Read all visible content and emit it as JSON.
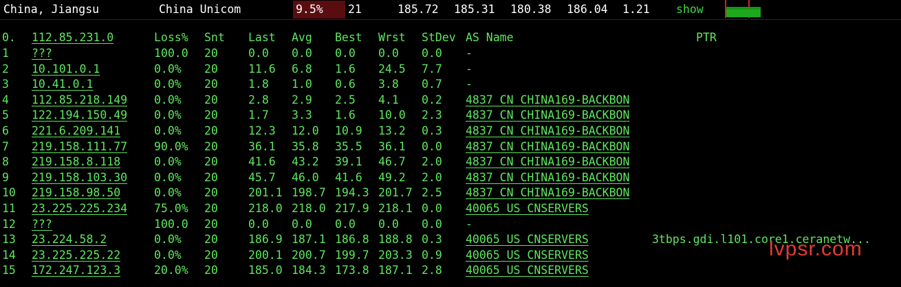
{
  "topbar": {
    "location": "China, Jiangsu",
    "isp": "China Unicom",
    "loss": "9.5%",
    "snt": "21",
    "last": "185.72",
    "avg": "185.31",
    "best": "180.38",
    "wrst": "186.04",
    "stdev": "1.21",
    "show": "show"
  },
  "header": {
    "hop": "0.",
    "host": "112.85.231.0",
    "loss": "Loss%",
    "snt": "Snt",
    "last": "Last",
    "avg": "Avg",
    "best": "Best",
    "wrst": "Wrst",
    "stdev": "StDev",
    "as": "AS Name",
    "ptr": "PTR"
  },
  "rows": [
    {
      "hop": "1",
      "host": "???",
      "loss": "100.0",
      "snt": "20",
      "last": "0.0",
      "avg": "0.0",
      "best": "0.0",
      "wrst": "0.0",
      "stdev": "0.0",
      "as": "-",
      "ptr": ""
    },
    {
      "hop": "2",
      "host": "10.101.0.1",
      "loss": "0.0%",
      "snt": "20",
      "last": "11.6",
      "avg": "6.8",
      "best": "1.6",
      "wrst": "24.5",
      "stdev": "7.7",
      "as": "-",
      "ptr": ""
    },
    {
      "hop": "3",
      "host": "10.41.0.1",
      "loss": "0.0%",
      "snt": "20",
      "last": "1.8",
      "avg": "1.0",
      "best": "0.6",
      "wrst": "3.8",
      "stdev": "0.7",
      "as": "-",
      "ptr": ""
    },
    {
      "hop": "4",
      "host": "112.85.218.149",
      "loss": "0.0%",
      "snt": "20",
      "last": "2.8",
      "avg": "2.9",
      "best": "2.5",
      "wrst": "4.1",
      "stdev": "0.2",
      "as": "4837  CN CHINA169-BACKBON",
      "ptr": ""
    },
    {
      "hop": "5",
      "host": "122.194.150.49",
      "loss": "0.0%",
      "snt": "20",
      "last": "1.7",
      "avg": "3.3",
      "best": "1.6",
      "wrst": "10.0",
      "stdev": "2.3",
      "as": "4837  CN CHINA169-BACKBON",
      "ptr": ""
    },
    {
      "hop": "6",
      "host": "221.6.209.141",
      "loss": "0.0%",
      "snt": "20",
      "last": "12.3",
      "avg": "12.0",
      "best": "10.9",
      "wrst": "13.2",
      "stdev": "0.3",
      "as": "4837  CN CHINA169-BACKBON",
      "ptr": ""
    },
    {
      "hop": "7",
      "host": "219.158.111.77",
      "loss": "90.0%",
      "snt": "20",
      "last": "36.1",
      "avg": "35.8",
      "best": "35.5",
      "wrst": "36.1",
      "stdev": "0.0",
      "as": "4837  CN CHINA169-BACKBON",
      "ptr": ""
    },
    {
      "hop": "8",
      "host": "219.158.8.118",
      "loss": "0.0%",
      "snt": "20",
      "last": "41.6",
      "avg": "43.2",
      "best": "39.1",
      "wrst": "46.7",
      "stdev": "2.0",
      "as": "4837  CN CHINA169-BACKBON",
      "ptr": ""
    },
    {
      "hop": "9",
      "host": "219.158.103.30",
      "loss": "0.0%",
      "snt": "20",
      "last": "45.7",
      "avg": "46.0",
      "best": "41.6",
      "wrst": "49.2",
      "stdev": "2.0",
      "as": "4837  CN CHINA169-BACKBON",
      "ptr": ""
    },
    {
      "hop": "10",
      "host": "219.158.98.50",
      "loss": "0.0%",
      "snt": "20",
      "last": "201.1",
      "avg": "198.7",
      "best": "194.3",
      "wrst": "201.7",
      "stdev": "2.5",
      "as": "4837  CN CHINA169-BACKBON",
      "ptr": ""
    },
    {
      "hop": "11",
      "host": "23.225.225.234",
      "loss": "75.0%",
      "snt": "20",
      "last": "218.0",
      "avg": "218.0",
      "best": "217.9",
      "wrst": "218.1",
      "stdev": "0.0",
      "as": "40065 US CNSERVERS",
      "ptr": ""
    },
    {
      "hop": "12",
      "host": "???",
      "loss": "100.0",
      "snt": "20",
      "last": "0.0",
      "avg": "0.0",
      "best": "0.0",
      "wrst": "0.0",
      "stdev": "0.0",
      "as": "-",
      "ptr": ""
    },
    {
      "hop": "13",
      "host": "23.224.58.2",
      "loss": "0.0%",
      "snt": "20",
      "last": "186.9",
      "avg": "187.1",
      "best": "186.8",
      "wrst": "188.8",
      "stdev": "0.3",
      "as": "40065 US CNSERVERS",
      "ptr": "3tbps.gdi.l101.core1.ceranetw..."
    },
    {
      "hop": "14",
      "host": "23.225.225.22",
      "loss": "0.0%",
      "snt": "20",
      "last": "200.1",
      "avg": "200.7",
      "best": "199.7",
      "wrst": "203.3",
      "stdev": "0.9",
      "as": "40065 US CNSERVERS",
      "ptr": ""
    },
    {
      "hop": "15",
      "host": "172.247.123.3",
      "loss": "20.0%",
      "snt": "20",
      "last": "185.0",
      "avg": "184.3",
      "best": "173.8",
      "wrst": "187.1",
      "stdev": "2.8",
      "as": "40065 US CNSERVERS",
      "ptr": ""
    }
  ],
  "watermark": "lvpsr.com",
  "colors": {
    "text": "#5fe65f",
    "loss_highlight": "#5a0d10",
    "spark_green": "#1ea81e",
    "spark_red": "#d62020",
    "watermark": "#e43a3a"
  }
}
